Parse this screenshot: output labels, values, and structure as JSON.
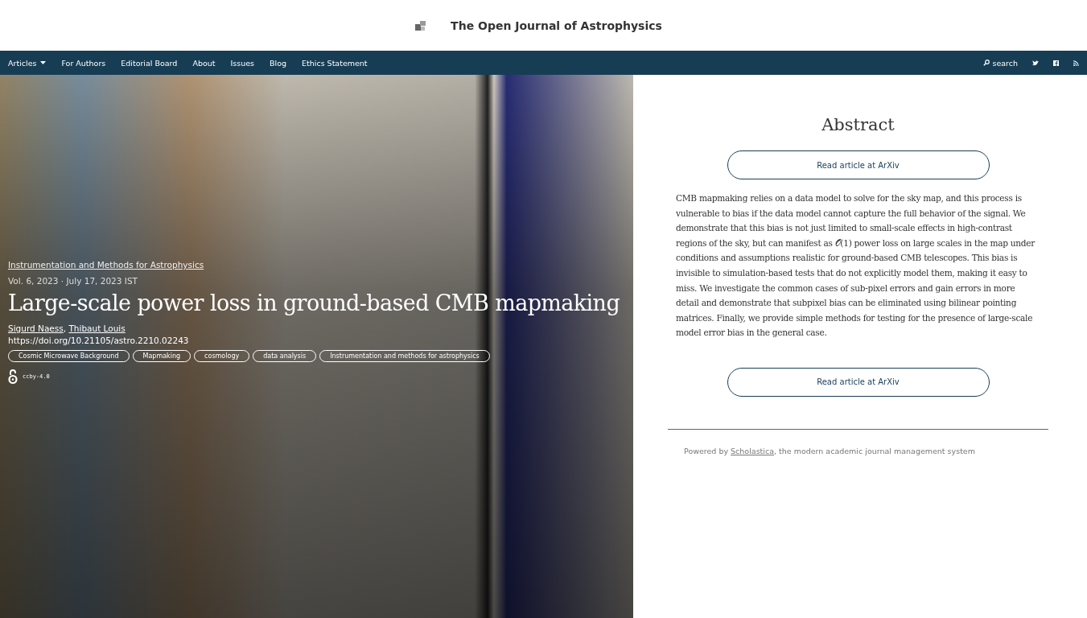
{
  "header": {
    "title": "The Open Journal of Astrophysics"
  },
  "nav": {
    "items": [
      {
        "label": "Articles",
        "dropdown": true
      },
      {
        "label": "For Authors",
        "dropdown": false
      },
      {
        "label": "Editorial Board",
        "dropdown": false
      },
      {
        "label": "About",
        "dropdown": false
      },
      {
        "label": "Issues",
        "dropdown": false
      },
      {
        "label": "Blog",
        "dropdown": false
      },
      {
        "label": "Ethics Statement",
        "dropdown": false
      }
    ],
    "search": "search"
  },
  "article": {
    "section": "Instrumentation and Methods for Astrophysics",
    "meta": "Vol. 6, 2023 · July 17, 2023 IST",
    "title": "Large-scale power loss in ground-based CMB mapmaking",
    "authors": [
      "Sigurd Naess",
      "Thibaut Louis"
    ],
    "author_separator": ", ",
    "doi": "https://doi.org/10.21105/astro.2210.02243",
    "tags": [
      "Cosmic Microwave Background",
      "Mapmaking",
      "cosmology",
      "data analysis",
      "Instrumentation and methods for astrophysics"
    ],
    "license": "ccby-4.0"
  },
  "abstract": {
    "heading": "Abstract",
    "button_top": "Read article at ArXiv",
    "text": "CMB mapmaking relies on a data model to solve for the sky map, and this process is vulnerable to bias if the data model cannot capture the full behavior of the signal. We demonstrate that this bias is not just limited to small-scale effects in high-contrast regions of the sky, but can manifest as 𝒪(1) power loss on large scales in the map under conditions and assumptions realistic for ground-based CMB telescopes. This bias is invisible to simulation-based tests that do not explicitly model them, making it easy to miss. We investigate the common cases of sub-pixel errors and gain errors in more detail and demonstrate that subpixel bias can be eliminated using bilinear pointing matrices. Finally, we provide simple methods for testing for the presence of large-scale model error bias in the general case.",
    "button_bottom": "Read article at ArXiv"
  },
  "footer": {
    "prefix": "Powered by",
    "link": "Scholastica",
    "suffix": ", the modern academic journal management system"
  }
}
